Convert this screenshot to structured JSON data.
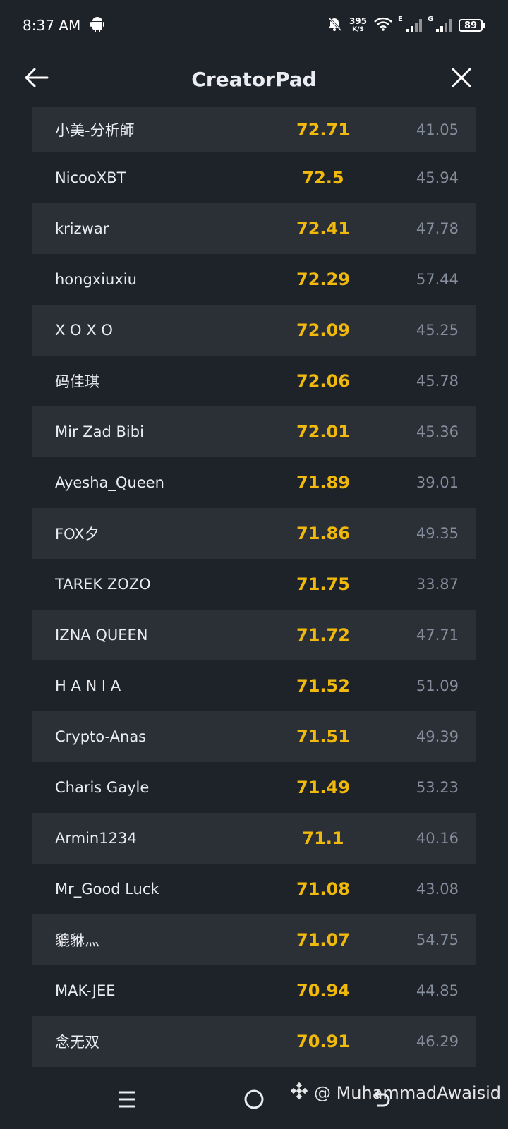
{
  "status_bar": {
    "time": "8:37 AM",
    "net_speed_value": "395",
    "net_speed_unit": "K/S",
    "sim1_tag": "E",
    "sim2_tag": "G",
    "battery": "89"
  },
  "header": {
    "title": "CreatorPad"
  },
  "rows": [
    {
      "name": "小美-分析師",
      "score": "72.71",
      "sub": "41.05"
    },
    {
      "name": "NicooXBT",
      "score": "72.5",
      "sub": "45.94"
    },
    {
      "name": "krizwar",
      "score": "72.41",
      "sub": "47.78"
    },
    {
      "name": "hongxiuxiu",
      "score": "72.29",
      "sub": "57.44"
    },
    {
      "name": "X O X O",
      "score": "72.09",
      "sub": "45.25"
    },
    {
      "name": "码佳琪",
      "score": "72.06",
      "sub": "45.78"
    },
    {
      "name": "Mir Zad Bibi",
      "score": "72.01",
      "sub": "45.36"
    },
    {
      "name": "Ayesha_Queen",
      "score": "71.89",
      "sub": "39.01"
    },
    {
      "name": "FOX夕",
      "score": "71.86",
      "sub": "49.35"
    },
    {
      "name": "TAREK ZOZO",
      "score": "71.75",
      "sub": "33.87"
    },
    {
      "name": "IZNA QUEEN",
      "score": "71.72",
      "sub": "47.71"
    },
    {
      "name": "H A N I A",
      "score": "71.52",
      "sub": "51.09"
    },
    {
      "name": "Crypto-Anas",
      "score": "71.51",
      "sub": "49.39"
    },
    {
      "name": "Charis Gayle",
      "score": "71.49",
      "sub": "53.23"
    },
    {
      "name": "Armin1234",
      "score": "71.1",
      "sub": "40.16"
    },
    {
      "name": "Mr_Good Luck",
      "score": "71.08",
      "sub": "43.08"
    },
    {
      "name": "貔貅灬",
      "score": "71.07",
      "sub": "54.75"
    },
    {
      "name": "MAK-JEE",
      "score": "70.94",
      "sub": "44.85"
    },
    {
      "name": "念无双",
      "score": "70.91",
      "sub": "46.29"
    }
  ],
  "watermark": {
    "text": "@ MuhammadAwaisid"
  },
  "colors": {
    "background": "#1e2229",
    "row_shade": "#2b2f36",
    "score": "#f0b90b",
    "secondary": "#848e9c",
    "text": "#eaecef"
  }
}
